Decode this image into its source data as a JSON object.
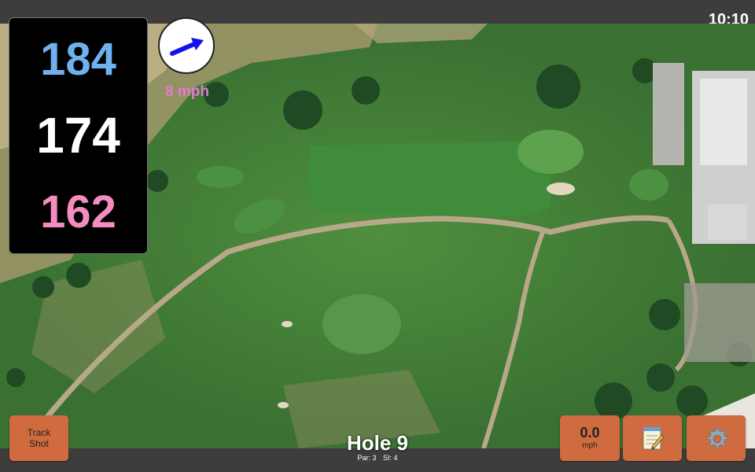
{
  "status": {
    "time": "10:10"
  },
  "distances": {
    "back": "184",
    "middle": "174",
    "front": "162",
    "colors": {
      "back": "#6fb1ef",
      "middle": "#ffffff",
      "front": "#f58cc0"
    }
  },
  "wind": {
    "speed_label": "8 mph",
    "icon": "wind-direction-arrow",
    "arrow_color": "#1010ee",
    "label_color": "#e37bd0"
  },
  "hole": {
    "title": "Hole 9",
    "par_label": "Par: 3",
    "si_label": "SI: 4"
  },
  "buttons": {
    "track_shot_line1": "Track",
    "track_shot_line2": "Shot",
    "speed_value": "0.0",
    "speed_unit": "mph",
    "notes_icon": "notepad-icon",
    "settings_icon": "gear-icon",
    "accent": "#d06a3f"
  }
}
